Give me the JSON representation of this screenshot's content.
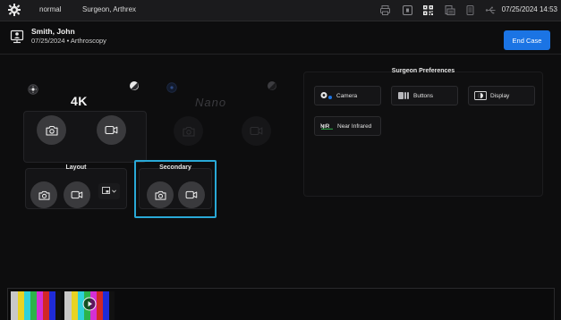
{
  "status_bar": {
    "mode": "normal",
    "profile": "Surgeon, Arthrex",
    "datetime": "07/25/2024 14:53",
    "icons": [
      "printer-icon",
      "record-icon",
      "qr-code-icon",
      "document-icon",
      "storage-icon",
      "usb-icon"
    ]
  },
  "patient": {
    "name": "Smith, John",
    "details": "07/25/2024 • Arthroscopy"
  },
  "actions": {
    "end_case": "End Case"
  },
  "panels": {
    "camera_4k": {
      "title": "4K"
    },
    "camera_nano": {
      "title": "Nano"
    },
    "layout": {
      "label": "Layout"
    },
    "secondary": {
      "label": "Secondary"
    }
  },
  "surgeon_preferences": {
    "title": "Surgeon Preferences",
    "buttons": [
      "Camera",
      "Buttons",
      "Display",
      "Near Infrared"
    ]
  },
  "colors": {
    "accent_blue": "#1b74e4",
    "highlight_cyan": "#29a8d6",
    "color_bars": [
      "#c8c8c8",
      "#e8d323",
      "#2fd1d9",
      "#2db34a",
      "#d52fd5",
      "#d12727",
      "#1f2bd8",
      "#111111"
    ]
  }
}
